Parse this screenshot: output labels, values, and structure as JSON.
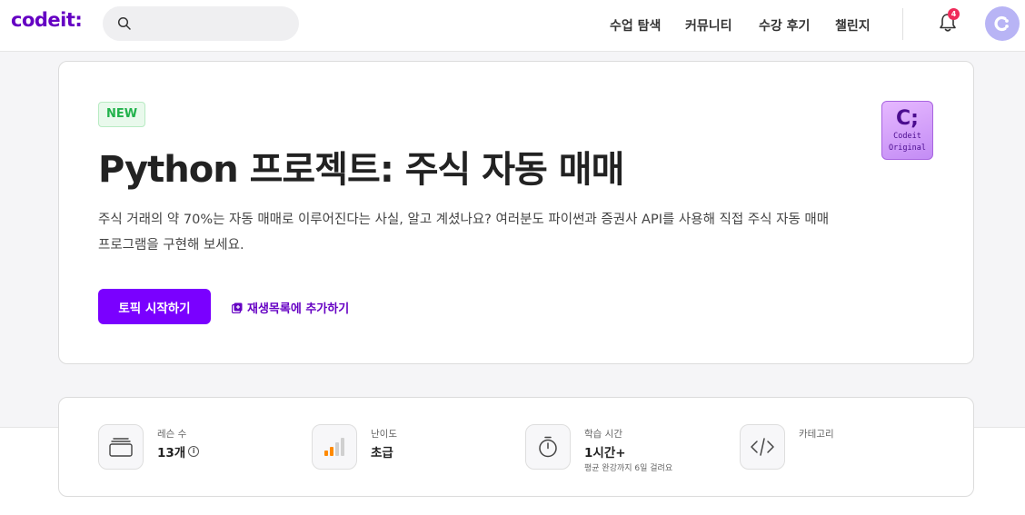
{
  "header": {
    "logo": "codeit:",
    "search": {
      "placeholder": ""
    },
    "nav": [
      "수업 탐색",
      "커뮤니티",
      "수강 후기",
      "챌린지"
    ],
    "notifications_count": "4",
    "icons": {
      "search": "search-icon",
      "bell": "bell-icon",
      "avatar": "avatar-icon"
    }
  },
  "hero": {
    "badge": "NEW",
    "title": "Python 프로젝트: 주식 자동 매매",
    "description_line1": "주식 거래의 약 70%는 자동 매매로 이루어진다는 사실, 알고 계셨나요? 여러분도 파이썬과 증권사 API를 사용해 직접 주식 자동 매매",
    "description_line2": "프로그램을 구현해 보세요.",
    "start_button": "토픽 시작하기",
    "playlist_link": "재생목록에 추가하기",
    "original_badge": {
      "symbol": "C;",
      "line1": "Codeit",
      "line2": "Original"
    }
  },
  "info": {
    "lessons": {
      "label": "레슨 수",
      "value": "13개",
      "info_icon": "i"
    },
    "difficulty": {
      "label": "난이도",
      "value": "초급"
    },
    "duration": {
      "label": "학습 시간",
      "value": "1시간+",
      "sub": "평균 완강까지 6일 걸려요"
    },
    "category": {
      "label": "카테고리",
      "value": ""
    }
  },
  "colors": {
    "brand": "#6500c3",
    "primary_button": "#7a00ff",
    "badge_new": "#22b24c",
    "notification": "#ef2b5a"
  }
}
